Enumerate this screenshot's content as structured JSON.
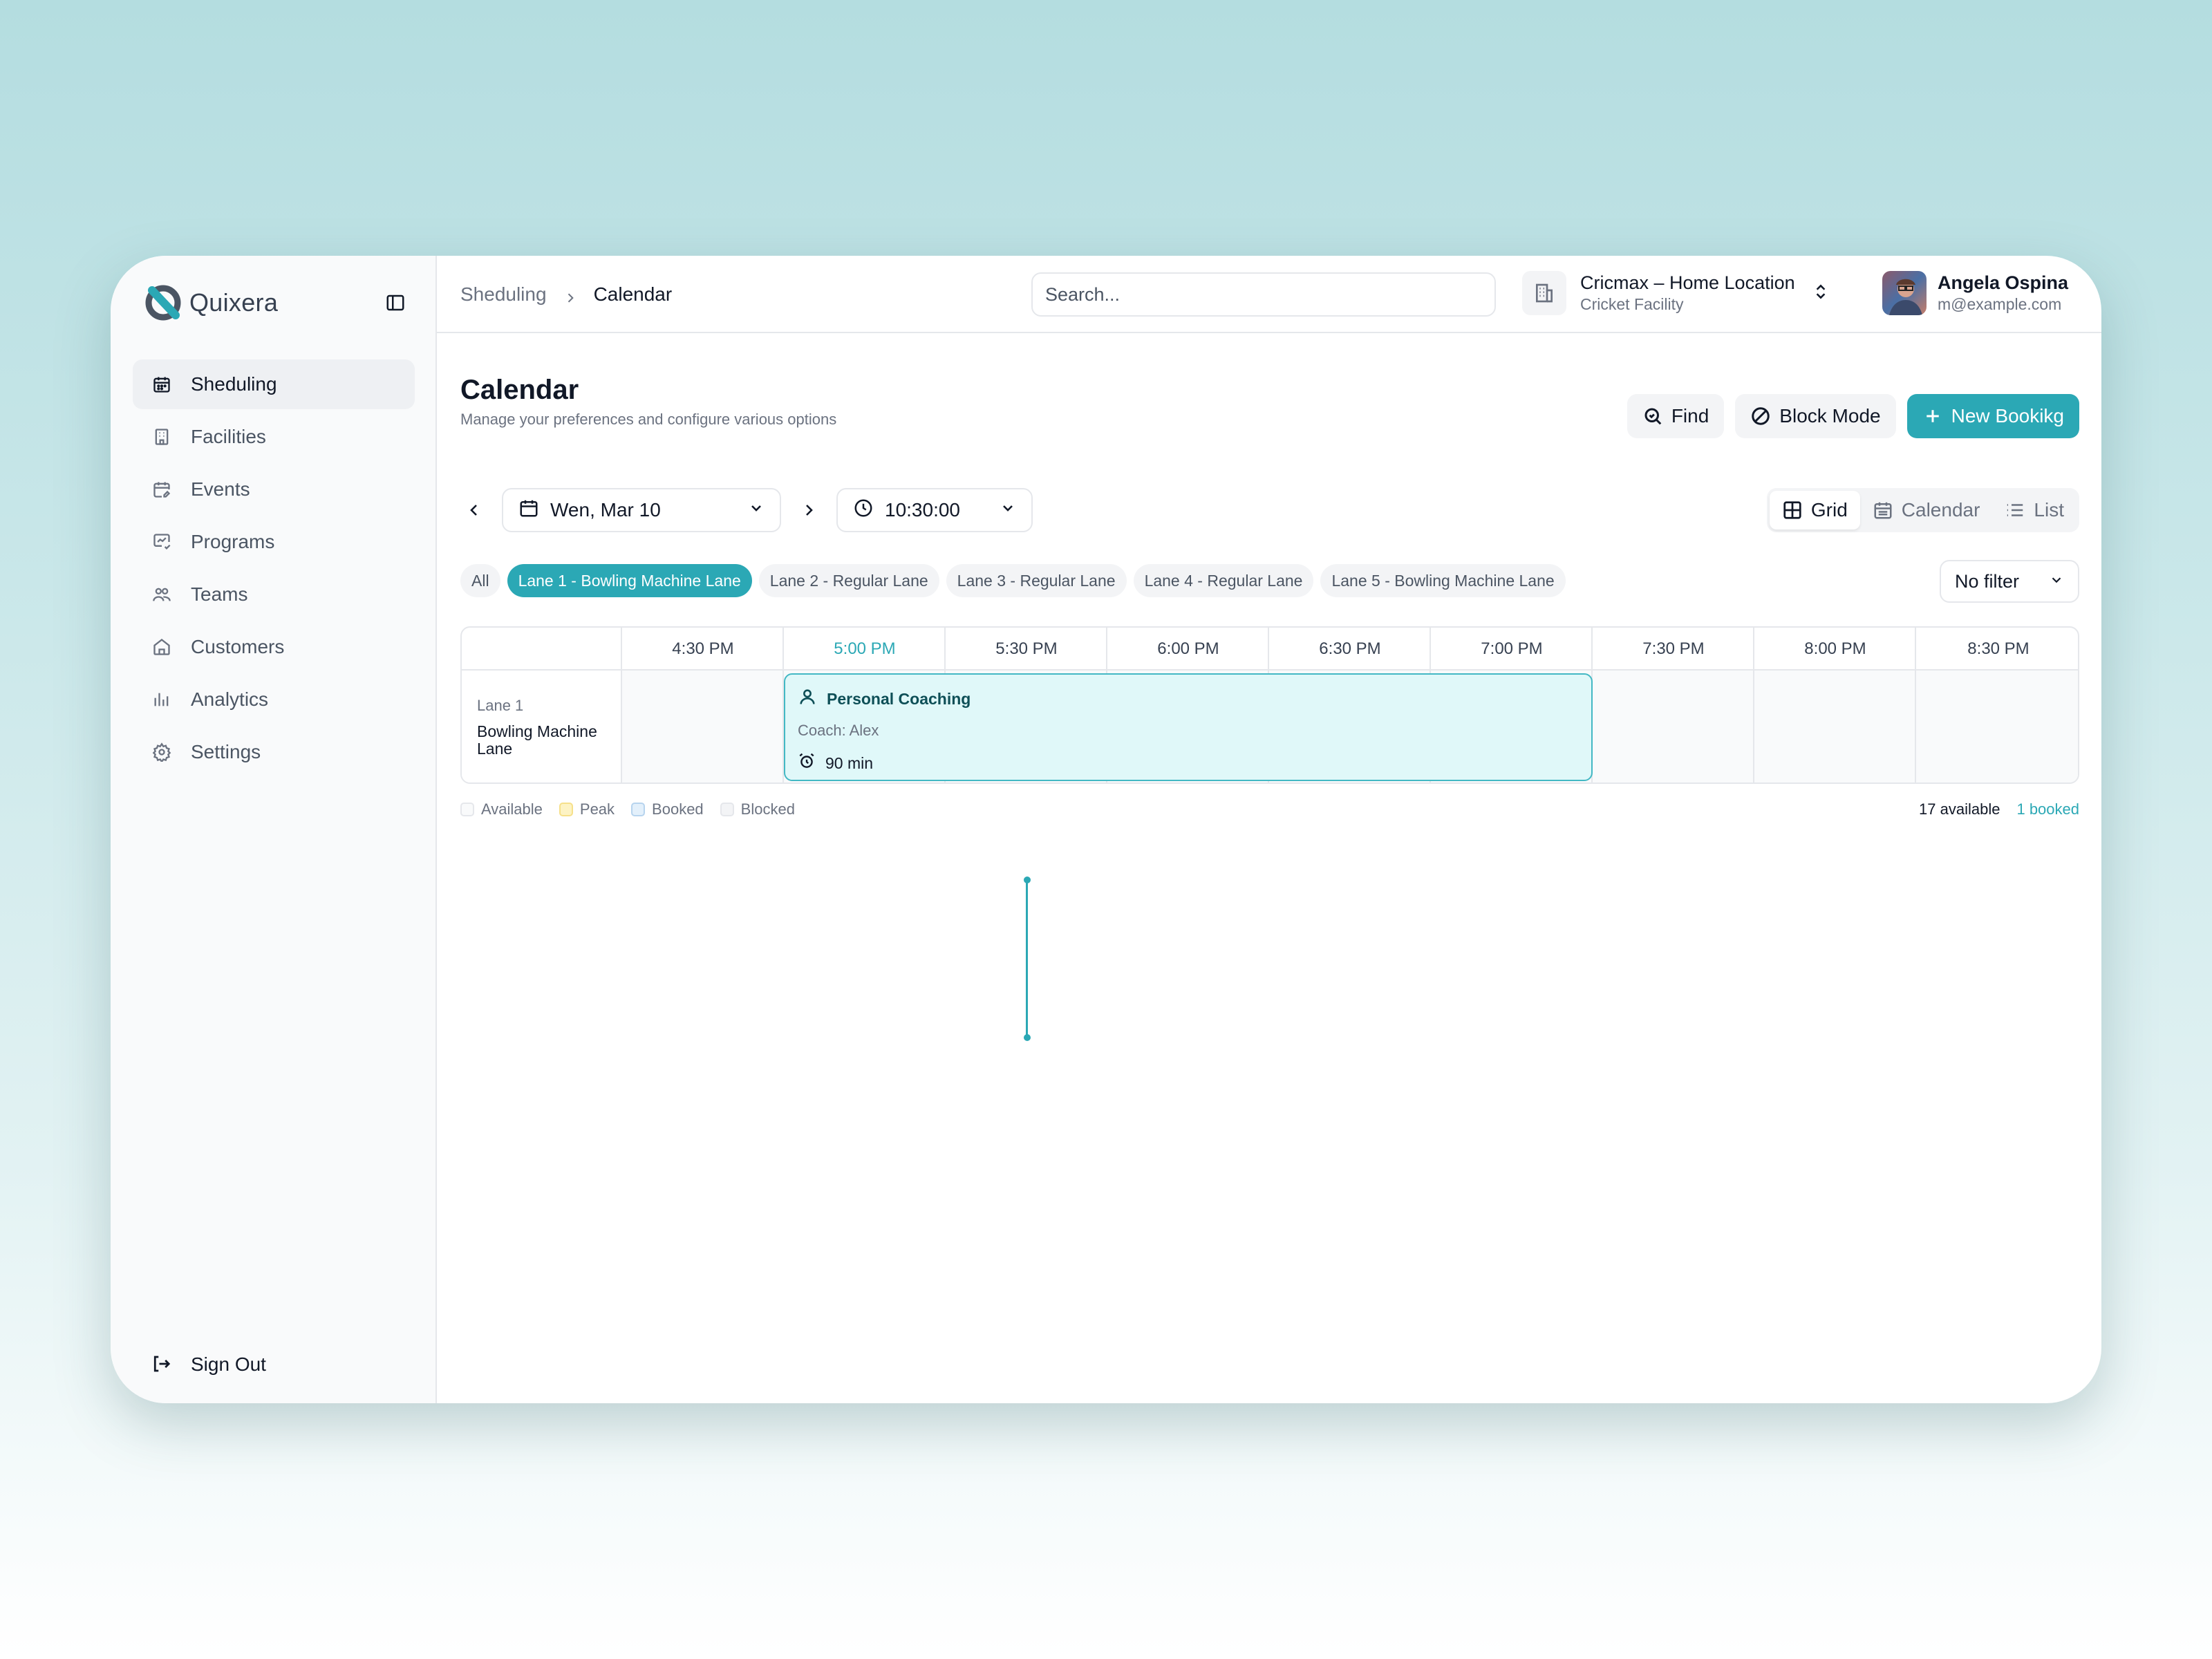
{
  "app": {
    "brand": "Quixera"
  },
  "sidebar": {
    "items": [
      {
        "label": "Sheduling",
        "icon": "calendar-icon",
        "active": true
      },
      {
        "label": "Facilities",
        "icon": "building-icon"
      },
      {
        "label": "Events",
        "icon": "calendar-edit-icon"
      },
      {
        "label": "Programs",
        "icon": "presentation-icon"
      },
      {
        "label": "Teams",
        "icon": "users-icon"
      },
      {
        "label": "Customers",
        "icon": "home-icon"
      },
      {
        "label": "Analytics",
        "icon": "bar-chart-icon"
      },
      {
        "label": "Settings",
        "icon": "gear-icon"
      }
    ],
    "signout": "Sign Out"
  },
  "topbar": {
    "breadcrumb": {
      "parent": "Sheduling",
      "current": "Calendar"
    },
    "search_placeholder": "Search...",
    "location": {
      "name": "Cricmax – Home Location",
      "type": "Cricket Facility"
    },
    "user": {
      "name": "Angela Ospina",
      "email": "m@example.com"
    }
  },
  "page": {
    "title": "Calendar",
    "subtitle": "Manage your preferences and configure various options",
    "find": "Find",
    "block_mode": "Block Mode",
    "new_booking": "New Bookikg"
  },
  "controls": {
    "date": "Wen, Mar 10",
    "time": "10:30:00",
    "views": {
      "grid": "Grid",
      "calendar": "Calendar",
      "list": "List"
    },
    "lanes": [
      "All",
      "Lane 1 - Bowling Machine Lane",
      "Lane 2 - Regular Lane",
      "Lane 3 - Regular Lane",
      "Lane 4 - Regular Lane",
      "Lane 5 - Bowling Machine Lane"
    ],
    "active_lane": 1,
    "filter": "No filter"
  },
  "schedule": {
    "times": [
      "4:30 PM",
      "5:00 PM",
      "5:30 PM",
      "6:00 PM",
      "6:30 PM",
      "7:00 PM",
      "7:30 PM",
      "8:00 PM",
      "8:30 PM"
    ],
    "current_time_label": "5:00 PM",
    "row": {
      "lane": "Lane 1",
      "name": "Bowling Machine Lane"
    },
    "booking": {
      "title": "Personal Coaching",
      "coach": "Coach: Alex",
      "duration": "90 min"
    }
  },
  "legend": [
    "Available",
    "Peak",
    "Booked",
    "Blocked"
  ],
  "stats": {
    "available": "17 available",
    "booked": "1 booked"
  },
  "colors": {
    "accent": "#2ba8b5",
    "booking_bg": "#e0f8f9",
    "peak": "#fdf3c4",
    "booked": "#e3f0fb"
  }
}
